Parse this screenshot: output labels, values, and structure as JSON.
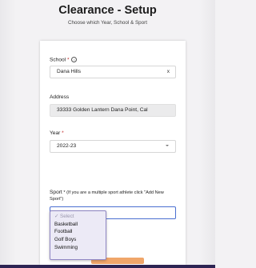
{
  "header": {
    "title": "Clearance - Setup",
    "subtitle": "Choose which Year, School & Sport"
  },
  "form": {
    "school": {
      "label": "School",
      "required_mark": "*",
      "info_icon": "info-circle-icon",
      "value": "Dana Hills",
      "clear_glyph": "x"
    },
    "address": {
      "label": "Address",
      "value": "33333 Golden Lantern Dana Point, Cal"
    },
    "year": {
      "label": "Year",
      "required_mark": "*",
      "value": "2022-23"
    },
    "sport": {
      "label": "Sport",
      "required_mark": "*",
      "hint": "(If you are a multiple sport athlete click \"Add New Sport\")",
      "options": [
        {
          "label": "✓ Select",
          "placeholder": true
        },
        {
          "label": "Basketball",
          "placeholder": false
        },
        {
          "label": "Football",
          "placeholder": false
        },
        {
          "label": "Golf Boys",
          "placeholder": false
        },
        {
          "label": "Swimming",
          "placeholder": false
        }
      ]
    }
  },
  "colors": {
    "accent_button": "#f0a66a",
    "dropdown_border": "#8f86c4",
    "focus_border": "#4a6fd1",
    "required": "#c02525"
  }
}
